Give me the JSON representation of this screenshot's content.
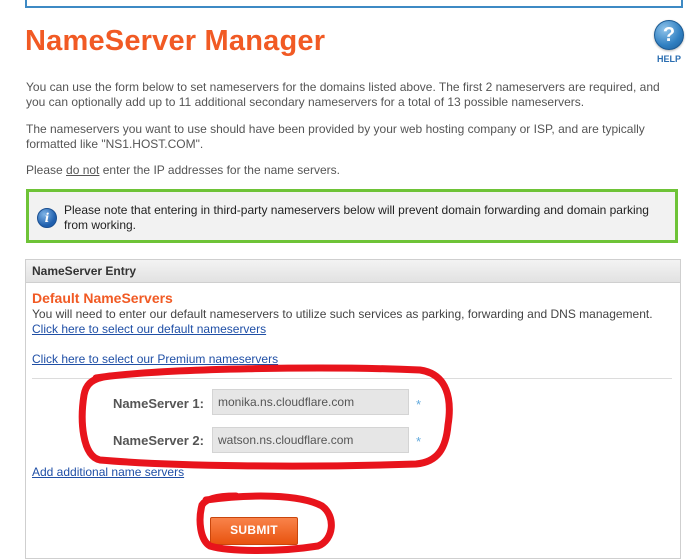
{
  "header": {
    "title": "NameServer Manager",
    "help_label": "HELP",
    "help_icon": "question-circle-icon"
  },
  "intro": {
    "paragraph1": "You can use the form below to set nameservers for the domains listed above. The first 2 nameservers are required, and you can optionally add up to 11 additional secondary nameservers for a total of 13 possible nameservers.",
    "paragraph2": "The nameservers you want to use should have been provided by your web hosting company or ISP, and are typically formatted like \"NS1.HOST.COM\".",
    "paragraph3_pre": "Please ",
    "paragraph3_emph": "do not",
    "paragraph3_post": " enter the IP addresses for the name servers."
  },
  "notice": {
    "icon": "info-icon",
    "text": "Please note that entering in third-party nameservers below will prevent domain forwarding and domain parking from working.",
    "border_color": "#6ec337"
  },
  "panel": {
    "header": "NameServer Entry",
    "section_title": "Default NameServers",
    "section_desc": "You will need to enter our default nameservers to utilize such services as parking, forwarding and DNS management.",
    "default_link": "Click here to select our default nameservers",
    "premium_link": "Click here to select our Premium nameservers",
    "fields": [
      {
        "label": "NameServer 1:",
        "value": "monika.ns.cloudflare.com",
        "required": "*"
      },
      {
        "label": "NameServer 2:",
        "value": "watson.ns.cloudflare.com",
        "required": "*"
      }
    ],
    "add_link": "Add additional name servers",
    "submit_label": "SUBMIT"
  },
  "colors": {
    "accent": "#f15a24",
    "link": "#1f4fa6",
    "annotation": "#e8141c"
  }
}
